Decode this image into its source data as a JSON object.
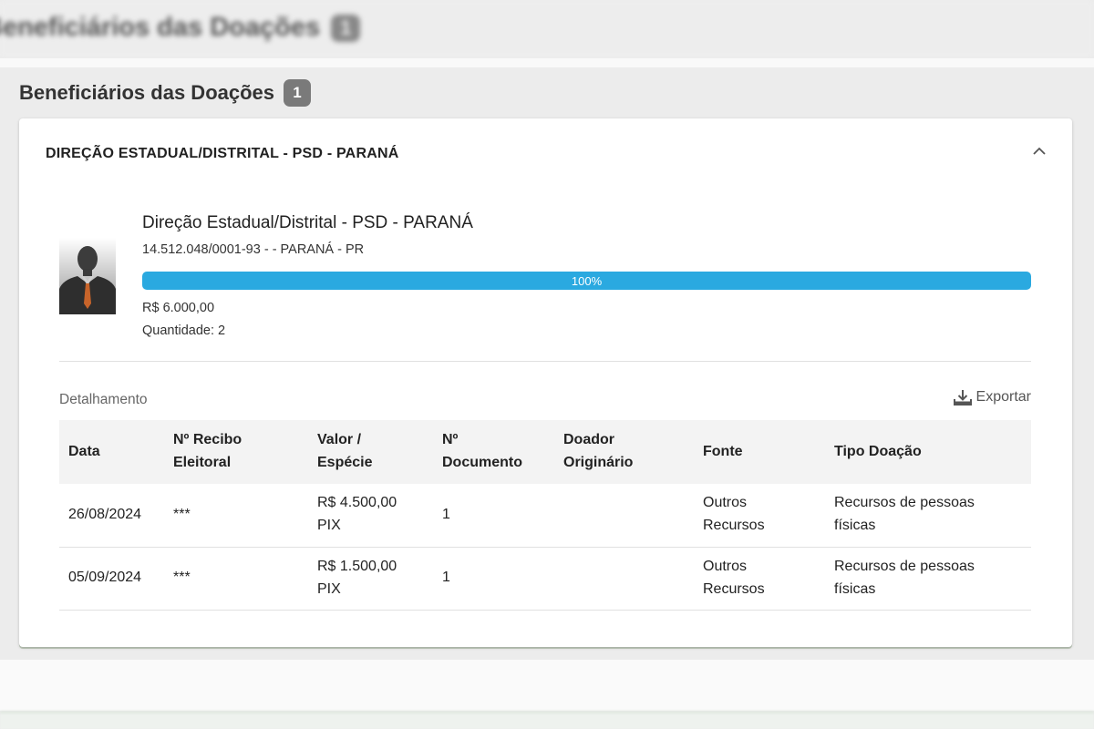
{
  "blurred_header": {
    "title": "Beneficiários das Doações",
    "count": "1"
  },
  "section": {
    "title": "Beneficiários das Doações",
    "count": "1"
  },
  "card": {
    "header": "DIREÇÃO ESTADUAL/DISTRITAL - PSD - PARANÁ",
    "collapse_icon": "chevron-up-icon",
    "entity": {
      "name": "Direção Estadual/Distrital - PSD - PARANÁ",
      "subtitle": "14.512.048/0001-93 - - PARANÁ - PR",
      "progress_value": 100,
      "progress_label": "100%",
      "total": "R$ 6.000,00",
      "quantity": "Quantidade: 2"
    },
    "detail_label": "Detalhamento",
    "export": {
      "label": "Exportar",
      "icon": "download-icon"
    },
    "table": {
      "headers": {
        "data": "Data",
        "recibo_1": "Nº Recibo",
        "recibo_2": "Eleitoral",
        "valor_1": "Valor /",
        "valor_2": "Espécie",
        "doc_1": "Nº",
        "doc_2": "Documento",
        "doador_1": "Doador",
        "doador_2": "Originário",
        "fonte": "Fonte",
        "tipo": "Tipo Doação"
      },
      "rows": [
        {
          "data": "26/08/2024",
          "recibo": "***",
          "valor": "R$ 4.500,00",
          "especie": "PIX",
          "documento": "1",
          "doador": "",
          "fonte_1": "Outros",
          "fonte_2": "Recursos",
          "tipo_1": "Recursos de pessoas",
          "tipo_2": "físicas"
        },
        {
          "data": "05/09/2024",
          "recibo": "***",
          "valor": "R$ 1.500,00",
          "especie": "PIX",
          "documento": "1",
          "doador": "",
          "fonte_1": "Outros",
          "fonte_2": "Recursos",
          "tipo_1": "Recursos de pessoas",
          "tipo_2": "físicas"
        }
      ]
    }
  },
  "colors": {
    "progress": "#2aa9e0",
    "badge": "#7a7a7a",
    "table_header_bg": "#f3f3f3"
  }
}
